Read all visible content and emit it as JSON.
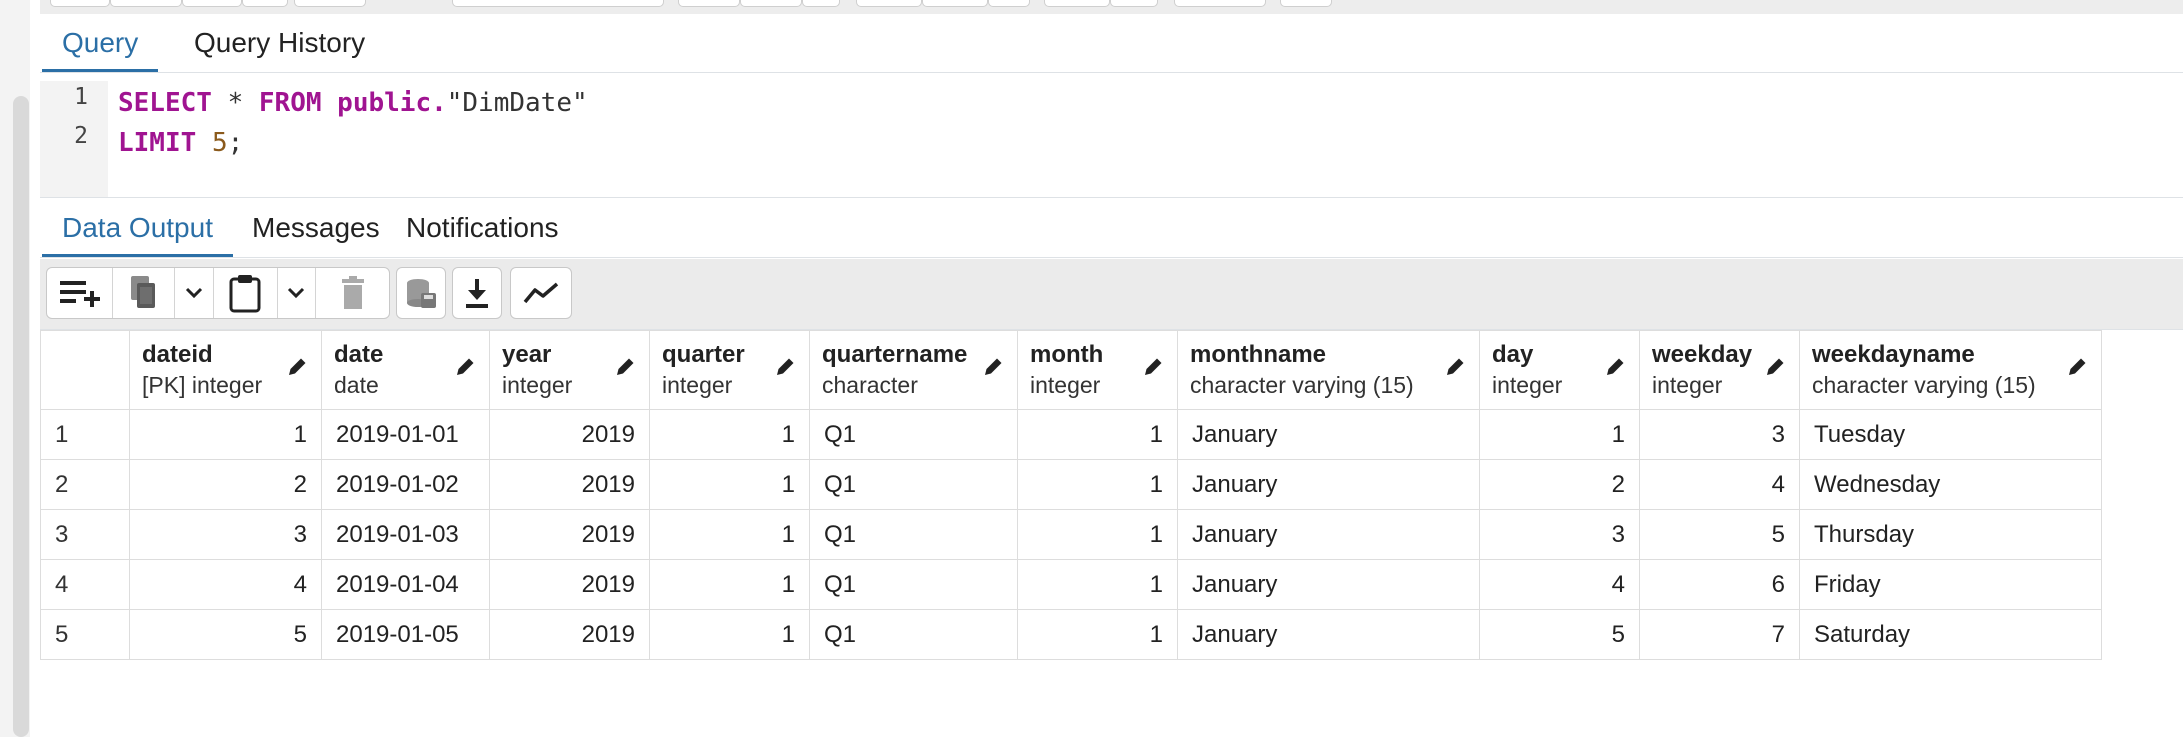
{
  "tabs": {
    "query": "Query",
    "history": "Query History"
  },
  "editor": {
    "line_numbers": [
      "1",
      "2"
    ],
    "line1": {
      "select": "SELECT",
      "star": " * ",
      "from": "FROM",
      "space": " ",
      "schema": "public.",
      "table": "\"DimDate\""
    },
    "line2": {
      "limit": "LIMIT",
      "space": " ",
      "value": "5",
      "semicolon": ";"
    }
  },
  "output_tabs": {
    "data_output": "Data Output",
    "messages": "Messages",
    "notifications": "Notifications"
  },
  "toolbar_icons": [
    "add-row-icon",
    "copy-icon",
    "chevron-down-icon",
    "paste-icon",
    "chevron-down-icon",
    "delete-icon",
    "save-data-icon",
    "download-icon",
    "graph-icon"
  ],
  "columns": [
    {
      "name": "dateid",
      "type": "[PK] integer"
    },
    {
      "name": "date",
      "type": "date"
    },
    {
      "name": "year",
      "type": "integer"
    },
    {
      "name": "quarter",
      "type": "integer"
    },
    {
      "name": "quartername",
      "type": "character"
    },
    {
      "name": "month",
      "type": "integer"
    },
    {
      "name": "monthname",
      "type": "character varying (15)"
    },
    {
      "name": "day",
      "type": "integer"
    },
    {
      "name": "weekday",
      "type": "integer"
    },
    {
      "name": "weekdayname",
      "type": "character varying (15)"
    }
  ],
  "rows": [
    {
      "n": "1",
      "dateid": "1",
      "date": "2019-01-01",
      "year": "2019",
      "quarter": "1",
      "quartername": "Q1",
      "month": "1",
      "monthname": "January",
      "day": "1",
      "weekday": "3",
      "weekdayname": "Tuesday"
    },
    {
      "n": "2",
      "dateid": "2",
      "date": "2019-01-02",
      "year": "2019",
      "quarter": "1",
      "quartername": "Q1",
      "month": "1",
      "monthname": "January",
      "day": "2",
      "weekday": "4",
      "weekdayname": "Wednesday"
    },
    {
      "n": "3",
      "dateid": "3",
      "date": "2019-01-03",
      "year": "2019",
      "quarter": "1",
      "quartername": "Q1",
      "month": "1",
      "monthname": "January",
      "day": "3",
      "weekday": "5",
      "weekdayname": "Thursday"
    },
    {
      "n": "4",
      "dateid": "4",
      "date": "2019-01-04",
      "year": "2019",
      "quarter": "1",
      "quartername": "Q1",
      "month": "1",
      "monthname": "January",
      "day": "4",
      "weekday": "6",
      "weekdayname": "Friday"
    },
    {
      "n": "5",
      "dateid": "5",
      "date": "2019-01-05",
      "year": "2019",
      "quarter": "1",
      "quartername": "Q1",
      "month": "1",
      "monthname": "January",
      "day": "5",
      "weekday": "7",
      "weekdayname": "Saturday"
    }
  ],
  "colors": {
    "active_tab": "#2b6fa6",
    "keyword": "#a01491",
    "number": "#8b5a1c"
  }
}
